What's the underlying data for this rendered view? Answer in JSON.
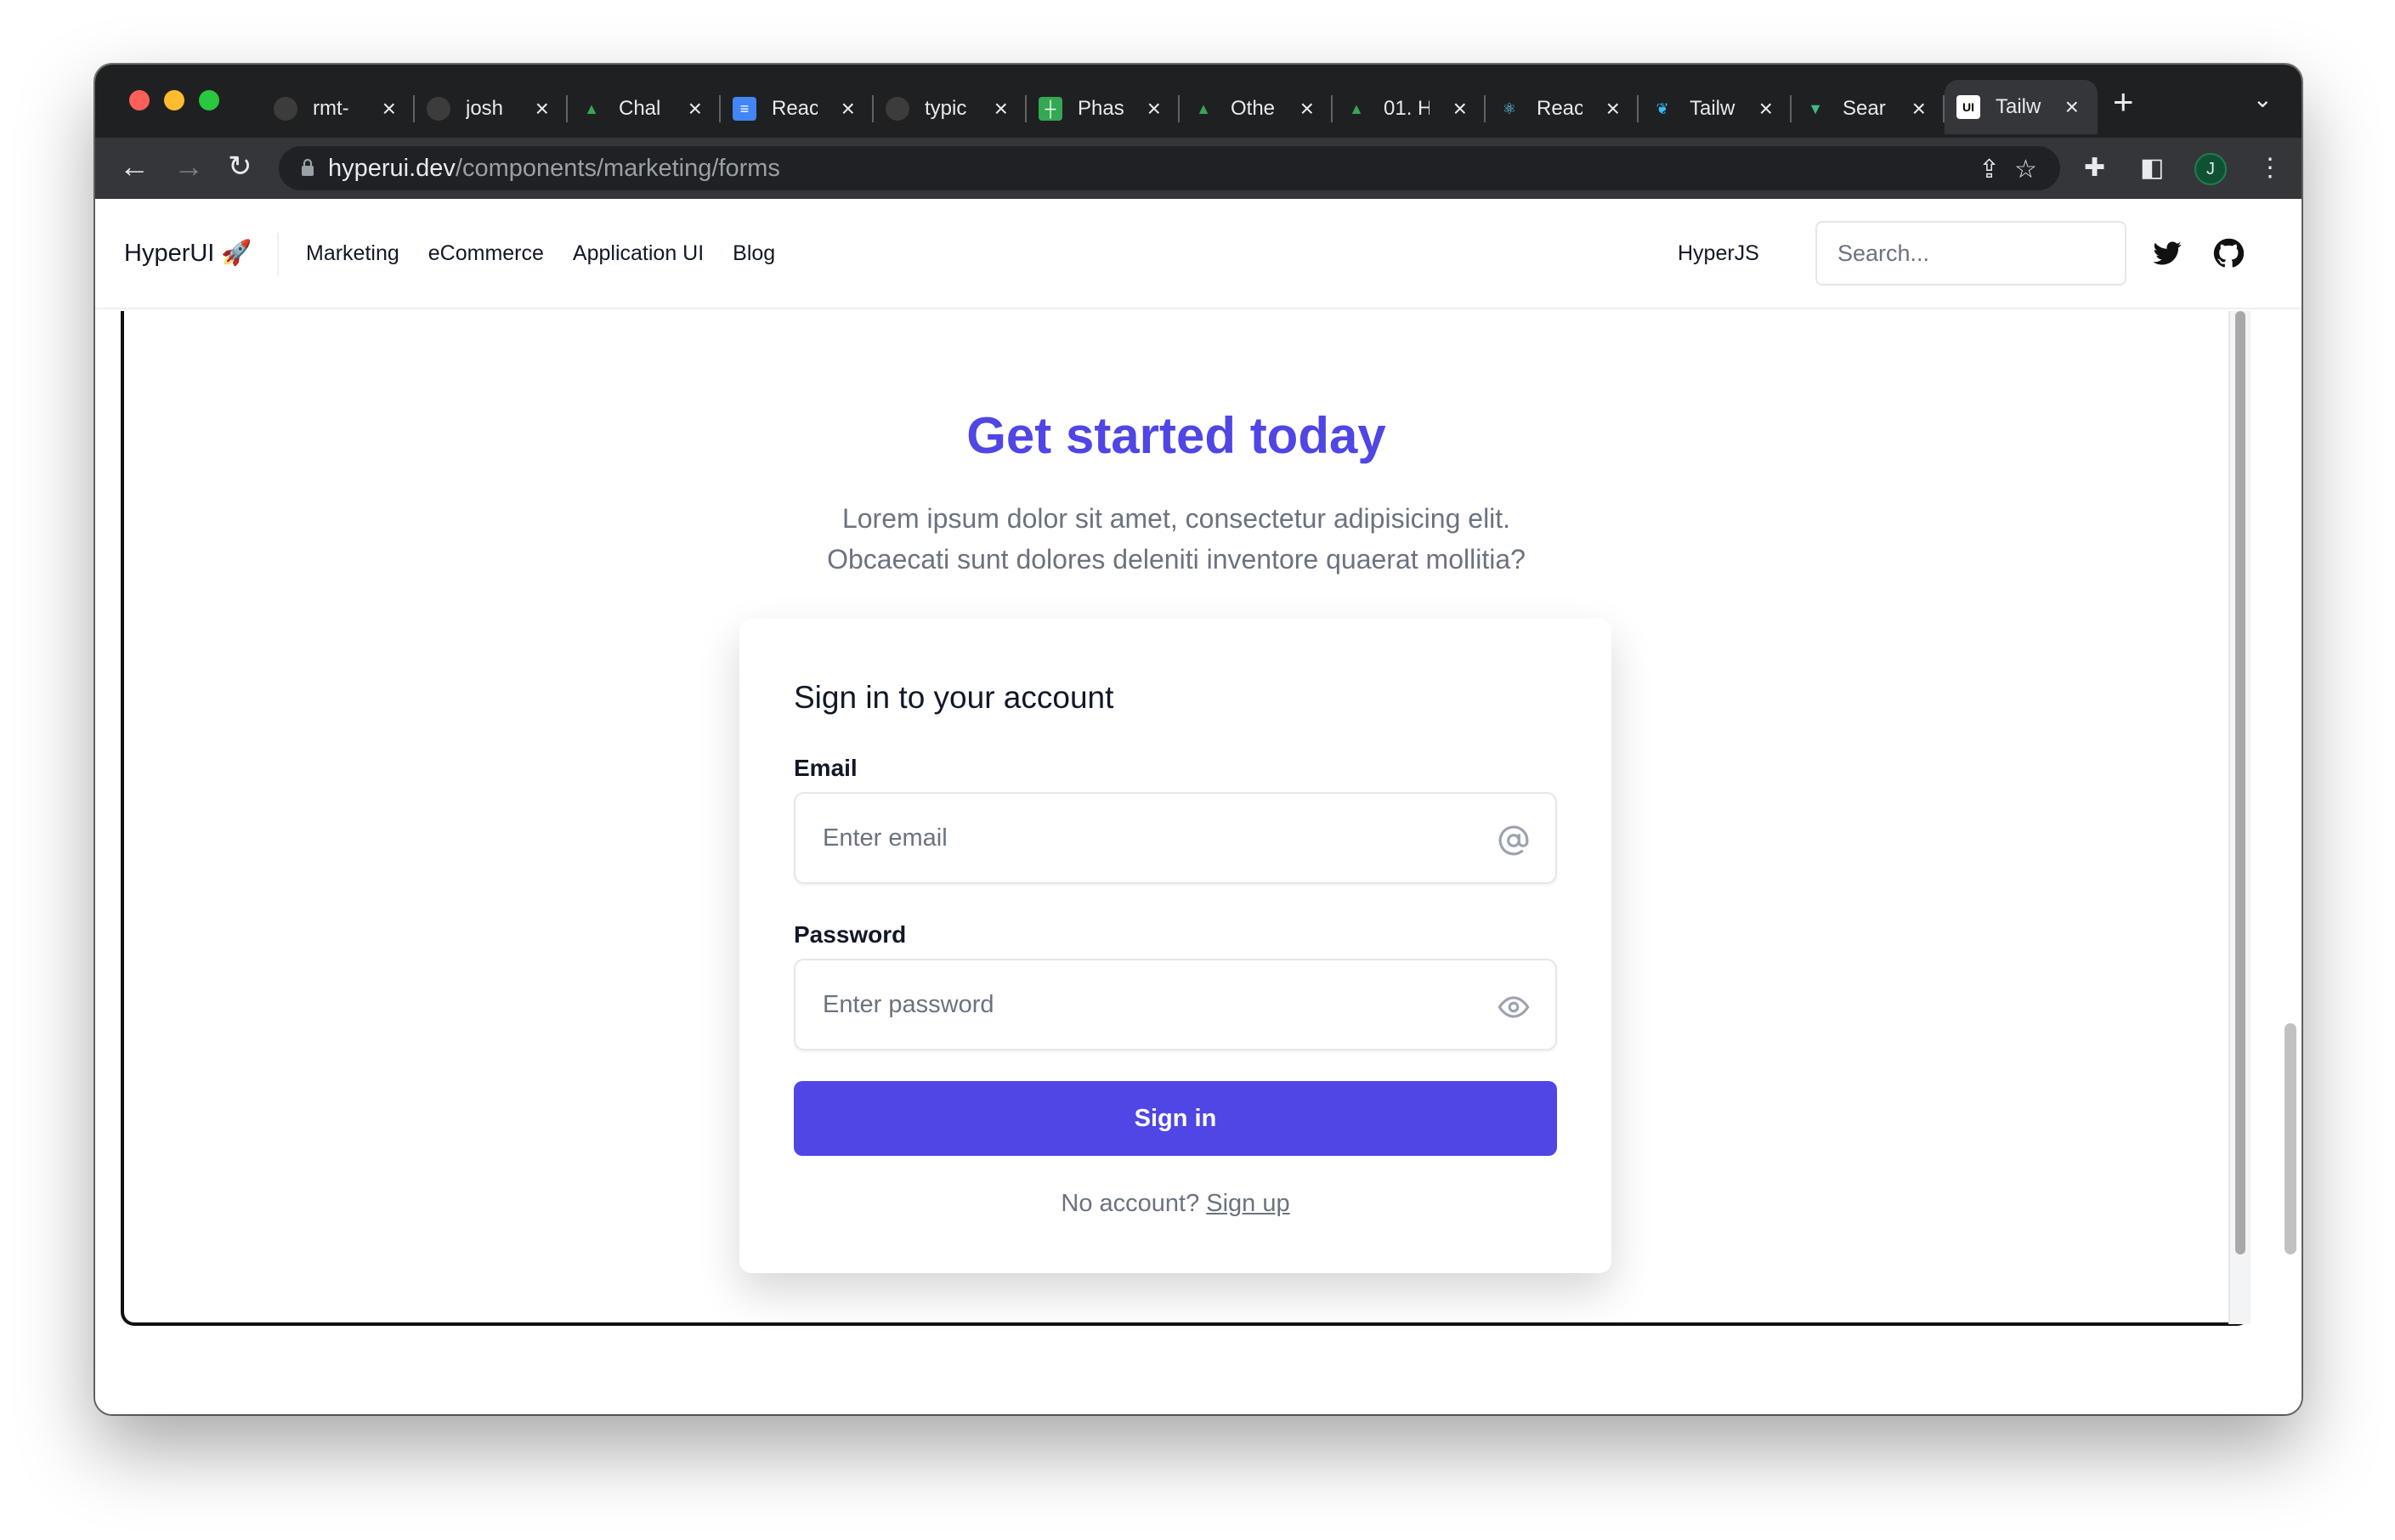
{
  "browser": {
    "tabs": [
      {
        "title": "rmt-",
        "icon": "github-icon",
        "active": false
      },
      {
        "title": "josh",
        "icon": "github-icon",
        "active": false
      },
      {
        "title": "Chal",
        "icon": "google-drive-icon",
        "active": false
      },
      {
        "title": "Reac",
        "icon": "google-docs-icon",
        "active": false
      },
      {
        "title": "typic",
        "icon": "github-icon",
        "active": false
      },
      {
        "title": "Phas",
        "icon": "google-sheets-icon",
        "active": false
      },
      {
        "title": "Othe",
        "icon": "google-drive-icon",
        "active": false
      },
      {
        "title": "01. H",
        "icon": "google-drive-icon",
        "active": false
      },
      {
        "title": "Reac",
        "icon": "react-icon",
        "active": false
      },
      {
        "title": "Tailw",
        "icon": "leaf-icon",
        "active": false
      },
      {
        "title": "Sear",
        "icon": "vue-icon",
        "active": false
      },
      {
        "title": "Tailw",
        "icon": "hyperui-icon",
        "active": true
      }
    ],
    "url_host": "hyperui.dev",
    "url_path": "/components/marketing/forms",
    "profile_initial": "J"
  },
  "site": {
    "logo": "HyperUI 🚀",
    "nav": [
      "Marketing",
      "eCommerce",
      "Application UI",
      "Blog"
    ],
    "hyperjs": "HyperJS",
    "search_placeholder": "Search..."
  },
  "hero": {
    "title": "Get started today",
    "subtitle_line1": "Lorem ipsum dolor sit amet, consectetur adipisicing elit.",
    "subtitle_line2": "Obcaecati sunt dolores deleniti inventore quaerat mollitia?"
  },
  "form": {
    "heading": "Sign in to your account",
    "email_label": "Email",
    "email_placeholder": "Enter email",
    "password_label": "Password",
    "password_placeholder": "Enter password",
    "submit_label": "Sign in",
    "no_account_text": "No account?",
    "signup_link": "Sign up"
  },
  "colors": {
    "accent": "#4f46e5",
    "tab_bar": "#1f2022",
    "toolbar": "#35363a"
  }
}
